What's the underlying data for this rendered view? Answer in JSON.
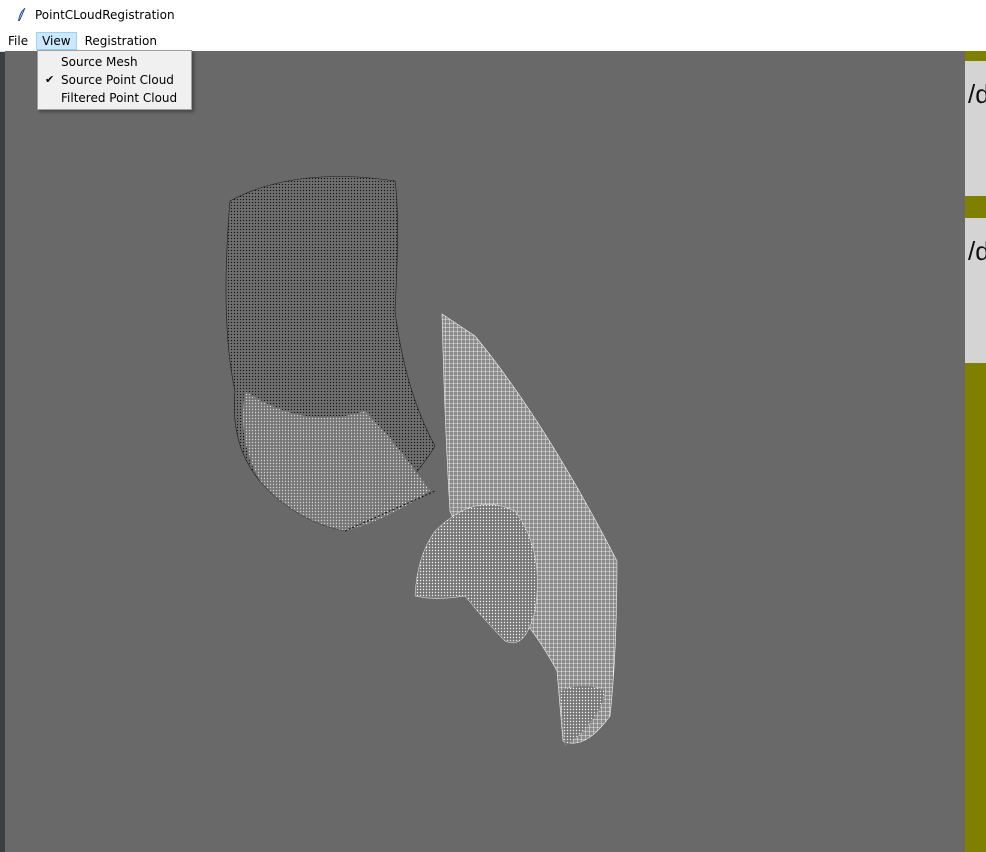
{
  "window": {
    "title": "PointCLoudRegistration"
  },
  "menubar": {
    "items": [
      "File",
      "View",
      "Registration"
    ],
    "active": "View"
  },
  "view_menu": {
    "items": [
      {
        "label": "Source Mesh",
        "checked": false
      },
      {
        "label": "Source Point Cloud",
        "checked": true
      },
      {
        "label": "Filtered Point Cloud",
        "checked": false
      }
    ]
  },
  "right_panel": {
    "boxes": [
      "/d/",
      "/d/"
    ]
  },
  "colors": {
    "viewport_bg": "#696969",
    "panel_accent": "#808000",
    "panel_box": "#d4d4d4",
    "menu_highlight": "#cce8ff"
  }
}
